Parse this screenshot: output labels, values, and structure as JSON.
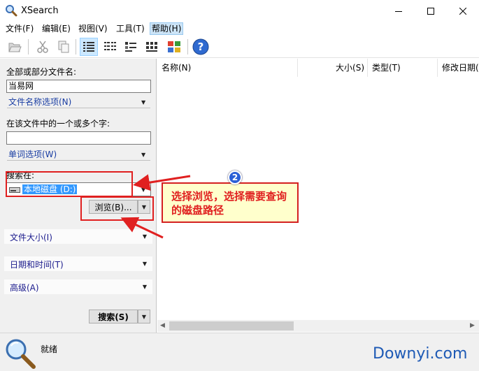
{
  "window": {
    "title": "XSearch"
  },
  "menu": [
    {
      "label": "文件(F)"
    },
    {
      "label": "编辑(E)"
    },
    {
      "label": "视图(V)"
    },
    {
      "label": "工具(T)"
    },
    {
      "label": "帮助(H)"
    }
  ],
  "search_panel": {
    "filename_label": "全部或部分文件名:",
    "filename_value": "当易网",
    "filename_options": "文件名称选项(N)",
    "content_label": "在该文件中的一个或多个字:",
    "content_value": "",
    "word_options": "单词选项(W)",
    "search_in_label": "搜索在:",
    "drive_value": "本地磁盘 (D:)",
    "browse_button": "浏览(B)...",
    "file_size": "文件大小(I)",
    "date_time": "日期和时间(T)",
    "advanced": "高级(A)",
    "search_button": "搜索(S)"
  },
  "results": {
    "columns": [
      "名称(N)",
      "大小(S)",
      "类型(T)",
      "修改日期(D)"
    ]
  },
  "status": {
    "text": "就绪"
  },
  "annotation": {
    "step": "2",
    "text": "选择浏览，选择需要查询的磁盘路径"
  },
  "watermark": "Downyi.com",
  "colors": {
    "accent": "#3399ff",
    "annotation_red": "#e02020",
    "callout_bg": "#ffffcc",
    "link_blue": "#1a3ea3"
  }
}
